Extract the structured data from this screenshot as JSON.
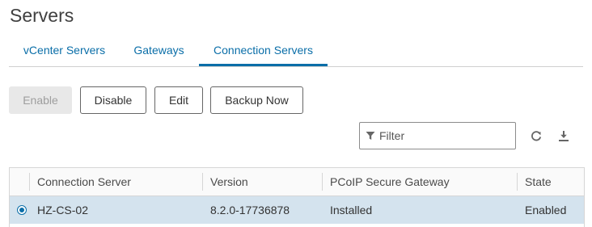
{
  "page": {
    "title": "Servers"
  },
  "tabs": [
    {
      "label": "vCenter Servers",
      "active": false
    },
    {
      "label": "Gateways",
      "active": false
    },
    {
      "label": "Connection Servers",
      "active": true
    }
  ],
  "toolbar": {
    "enable_label": "Enable",
    "enable_disabled": true,
    "disable_label": "Disable",
    "edit_label": "Edit",
    "backup_label": "Backup Now"
  },
  "filter": {
    "placeholder": "Filter",
    "value": ""
  },
  "icons": {
    "filter": "filter-icon",
    "refresh": "refresh-icon",
    "download": "download-icon",
    "radio": "radio-selected-icon"
  },
  "grid": {
    "columns": [
      "Connection Server",
      "Version",
      "PCoIP Secure Gateway",
      "State"
    ],
    "rows": [
      {
        "selected": true,
        "cells": [
          "HZ-CS-02",
          "8.2.0-17736878",
          "Installed",
          "Enabled"
        ]
      }
    ]
  },
  "colors": {
    "accent": "#0a6ea8",
    "selected_row": "#d4e3ee",
    "disabled_button": "#e8e8e8"
  }
}
